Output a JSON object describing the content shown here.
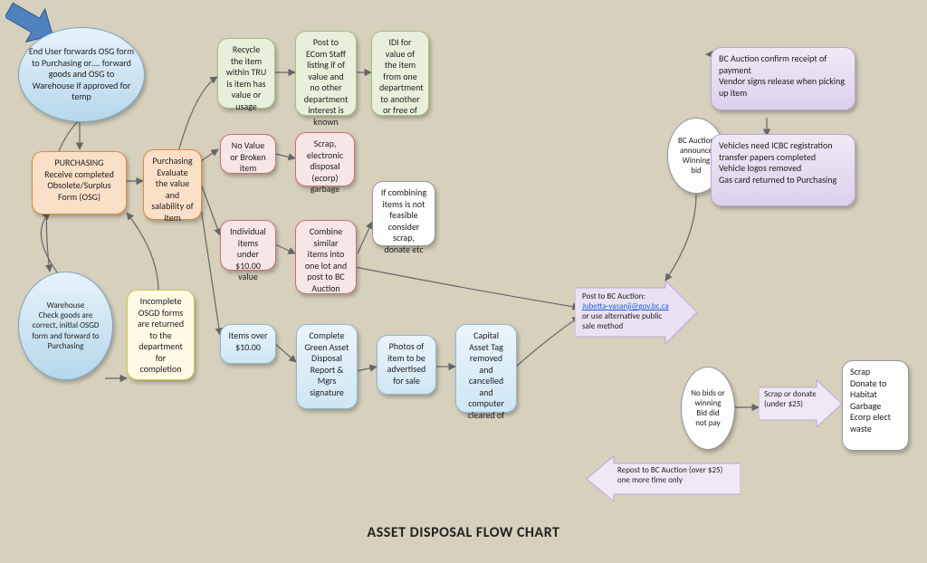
{
  "title": "ASSET DISPOSAL FLOW CHART",
  "start_arrow": "start",
  "nodes": {
    "end_user": "End User forwards OSG form to Purchasing or…. forward goods and OSG to Warehouse if approved for temp",
    "purchasing_recv": "PURCHASING Receive completed Obsolete/Surplus Form (OSG)",
    "purch_eval": "Purchasing Evaluate the value and salability of item",
    "warehouse": "Warehouse\nCheck goods are correct, initial OSGD form and forward to Purchasing",
    "incomplete": "Incomplete OSGD forms are returned to the department for completion",
    "recycle": "Recycle the item within TRU is item has value or usage",
    "post_ecom": "Post to ECom Staff listing if of value and no other department interest is known",
    "idi": "IDI for value of the item from one department to another or free of",
    "no_value": "No Value or Broken item",
    "scrap_ecorp": "Scrap, electronic disposal (ecorp) garbage",
    "under10": "Individual items under $10.00 value",
    "combine": "Combine similar items into one lot and post to BC Auction",
    "combine_not": "If combining items is not feasible consider scrap, donate etc",
    "over10": "Items over $10.00",
    "green_report": "Complete Green Asset Disposal Report & Mgrs signature",
    "photos": "Photos of item to be advertised for sale",
    "capital_tag": "Capital Asset Tag removed and cancelled and computer cleared of",
    "post_auction": {
      "pre": "Post to BC Auction:",
      "link": "Jubetta-vasanji@gov.bc.ca",
      "post": "or use alternative public sale method"
    },
    "winning": "BC Auction announce Winning bid",
    "confirm": "BC Auction confirm receipt of payment\nVendor signs release when picking up item",
    "vehicles": "Vehicles need ICBC registration transfer papers completed\nVehicle logos removed\nGas card returned to Purchasing",
    "no_bids": "No bids or winning Bid did not pay",
    "scrap_donate": "Scrap or donate (under $25)",
    "end_opts": "Scrap\nDonate to Habitat\nGarbage\nEcorp elect waste",
    "repost": "Repost to BC Auction (over $25) one more time only"
  }
}
